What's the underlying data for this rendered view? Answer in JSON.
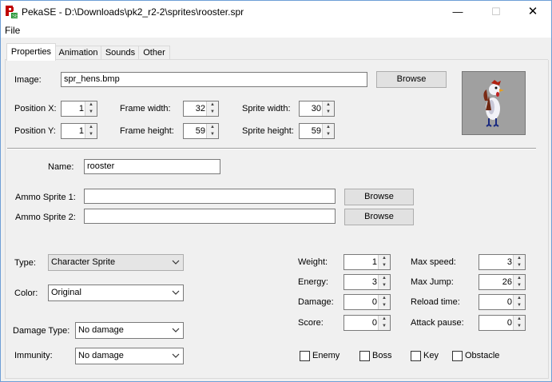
{
  "window": {
    "title": "PekaSE - D:\\Downloads\\pk2_r2-2\\sprites\\rooster.spr",
    "minimize_glyph": "—",
    "maximize_glyph": "☐",
    "close_glyph": "✕"
  },
  "menu": {
    "file": "File"
  },
  "tabs": [
    {
      "label": "Properties"
    },
    {
      "label": "Animation"
    },
    {
      "label": "Sounds"
    },
    {
      "label": "Other"
    }
  ],
  "image": {
    "label": "Image:",
    "value": "spr_hens.bmp",
    "browse": "Browse"
  },
  "position_x": {
    "label": "Position X:",
    "value": "1"
  },
  "position_y": {
    "label": "Position Y:",
    "value": "1"
  },
  "frame_width": {
    "label": "Frame width:",
    "value": "32"
  },
  "frame_height": {
    "label": "Frame height:",
    "value": "59"
  },
  "sprite_width": {
    "label": "Sprite width:",
    "value": "30"
  },
  "sprite_height": {
    "label": "Sprite height:",
    "value": "59"
  },
  "name": {
    "label": "Name:",
    "value": "rooster"
  },
  "ammo1": {
    "label": "Ammo Sprite 1:",
    "value": "",
    "browse": "Browse"
  },
  "ammo2": {
    "label": "Ammo Sprite 2:",
    "value": "",
    "browse": "Browse"
  },
  "type": {
    "label": "Type:",
    "value": "Character Sprite"
  },
  "color": {
    "label": "Color:",
    "value": "Original"
  },
  "damage_type": {
    "label": "Damage Type:",
    "value": "No damage"
  },
  "immunity": {
    "label": "Immunity:",
    "value": "No damage"
  },
  "weight": {
    "label": "Weight:",
    "value": "1"
  },
  "energy": {
    "label": "Energy:",
    "value": "3"
  },
  "damage": {
    "label": "Damage:",
    "value": "0"
  },
  "score": {
    "label": "Score:",
    "value": "0"
  },
  "max_speed": {
    "label": "Max speed:",
    "value": "3"
  },
  "max_jump": {
    "label": "Max Jump:",
    "value": "26"
  },
  "reload_time": {
    "label": "Reload time:",
    "value": "0"
  },
  "attack_pause": {
    "label": "Attack pause:",
    "value": "0"
  },
  "checkboxes": [
    {
      "label": "Enemy",
      "checked": false
    },
    {
      "label": "Boss",
      "checked": false
    },
    {
      "label": "Key",
      "checked": false
    },
    {
      "label": "Obstacle",
      "checked": false
    }
  ],
  "colors": {
    "window_border": "#6e9fd6",
    "panel": "#f0f0f0",
    "preview_bg": "#a0a0a0"
  }
}
